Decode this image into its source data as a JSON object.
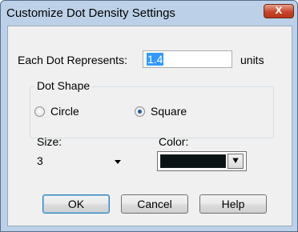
{
  "window": {
    "title": "Customize Dot Density Settings",
    "close_glyph": "x"
  },
  "dot": {
    "label": "Each Dot Represents:",
    "value": "1.4",
    "unit": "units"
  },
  "shape": {
    "group_label": "Dot Shape",
    "circle": "Circle",
    "square": "Square",
    "selected": "Square"
  },
  "size": {
    "label": "Size:",
    "value": "3"
  },
  "color": {
    "label": "Color:",
    "swatch": "#0a1414",
    "dropdown_glyph": "⯆"
  },
  "buttons": {
    "ok": "OK",
    "cancel": "Cancel",
    "help": "Help"
  }
}
